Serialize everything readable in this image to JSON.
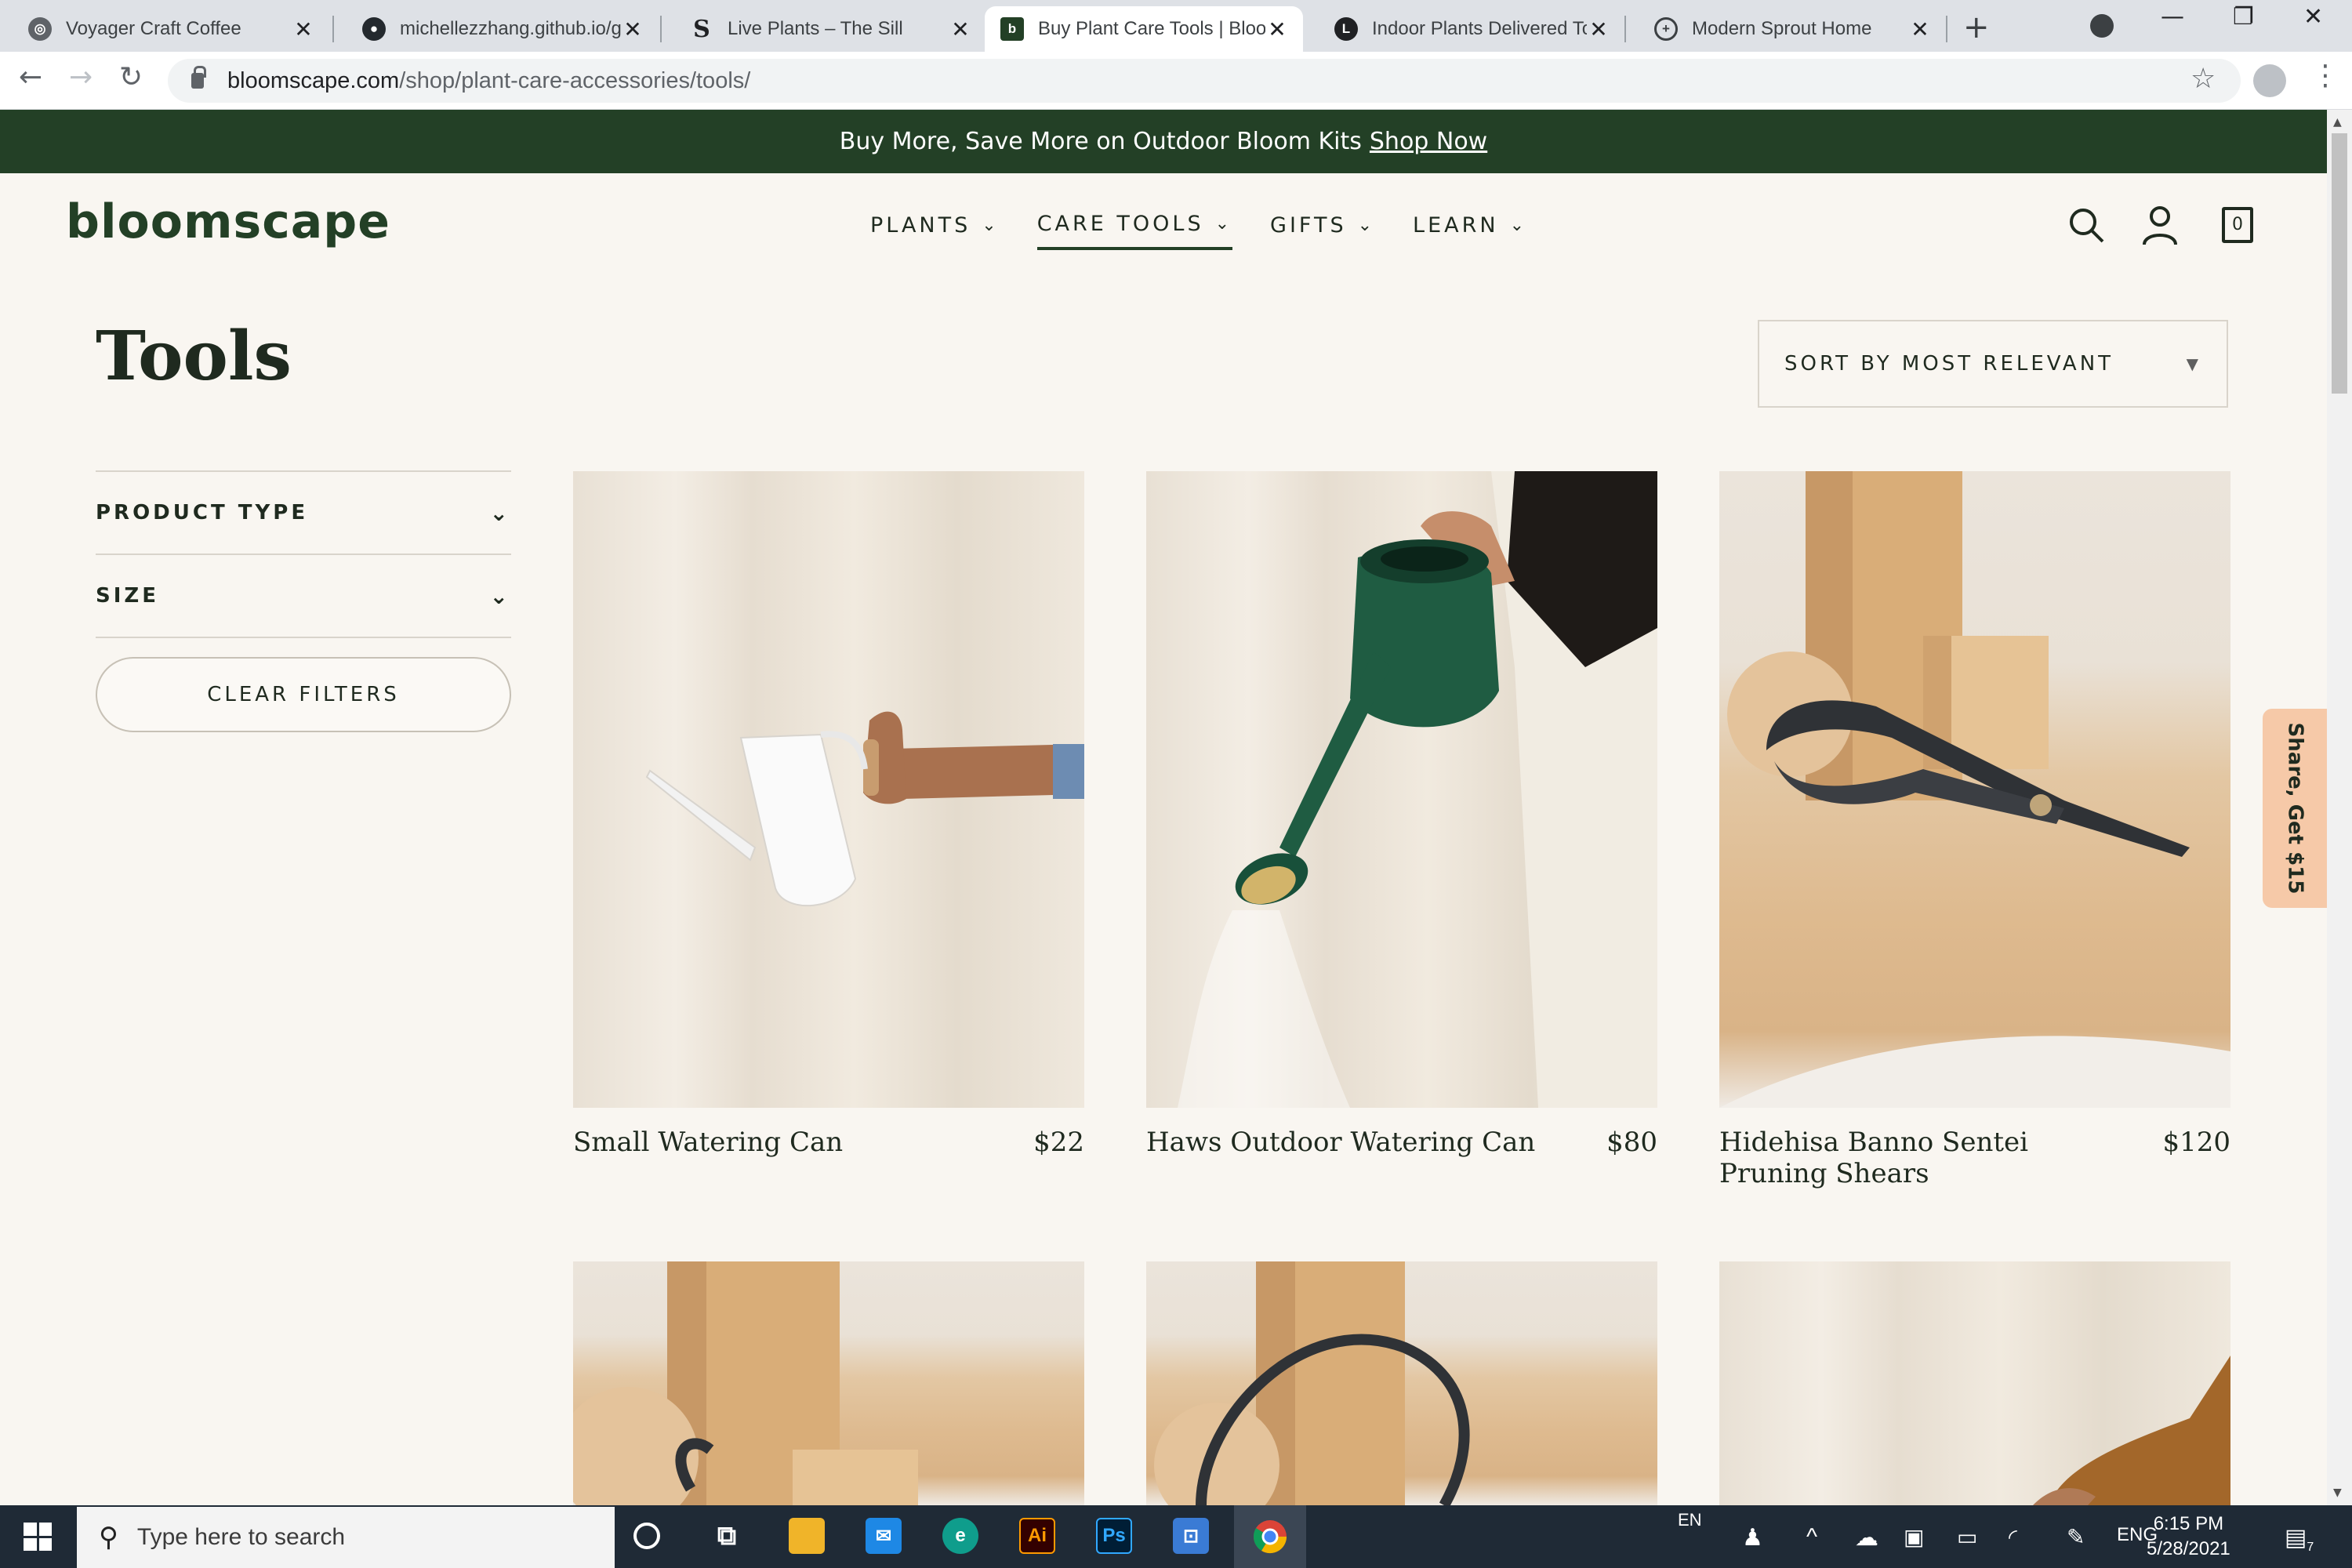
{
  "browser": {
    "tabs": [
      {
        "title": "Voyager Craft Coffee",
        "icon": "globe-icon",
        "active": false
      },
      {
        "title": "michellezzhang.github.io/g",
        "icon": "github-icon",
        "active": false
      },
      {
        "title": "Live Plants – The Sill",
        "icon": "the-sill-icon",
        "active": false
      },
      {
        "title": "Buy Plant Care Tools | Bloo",
        "icon": "bloomscape-icon",
        "active": true
      },
      {
        "title": "Indoor Plants Delivered To",
        "icon": "lula-icon",
        "active": false
      },
      {
        "title": "Modern Sprout Home",
        "icon": "modern-sprout-icon",
        "active": false
      }
    ],
    "url_host": "bloomscape.com",
    "url_path": "/shop/plant-care-accessories/tools/"
  },
  "promo": {
    "text": "Buy More, Save More on Outdoor Bloom Kits",
    "link": "Shop Now"
  },
  "header": {
    "logo": "bloomscape",
    "nav": [
      {
        "label": "PLANTS",
        "active": false
      },
      {
        "label": "CARE TOOLS",
        "active": true
      },
      {
        "label": "GIFTS",
        "active": false
      },
      {
        "label": "LEARN",
        "active": false
      }
    ],
    "cart_count": "0"
  },
  "page": {
    "title": "Tools",
    "sort_label": "SORT BY MOST RELEVANT"
  },
  "filters": {
    "items": [
      "PRODUCT TYPE",
      "SIZE"
    ],
    "clear_label": "CLEAR FILTERS"
  },
  "products": [
    {
      "name": "Small Watering Can",
      "price": "$22"
    },
    {
      "name": "Haws Outdoor Watering Can",
      "price": "$80"
    },
    {
      "name": "Hidehisa Banno Sentei Pruning Shears",
      "price": "$120"
    }
  ],
  "share": {
    "label": "Share, Get $15"
  },
  "taskbar": {
    "search_placeholder": "Type here to search",
    "lang_top": "EN",
    "lang": "ENG",
    "time": "6:15 PM",
    "date": "5/28/2021",
    "notification_count": "7"
  },
  "colors": {
    "brand_green": "#234026",
    "page_bg": "#f9f6f1",
    "share_tab": "#f6c9a8"
  }
}
